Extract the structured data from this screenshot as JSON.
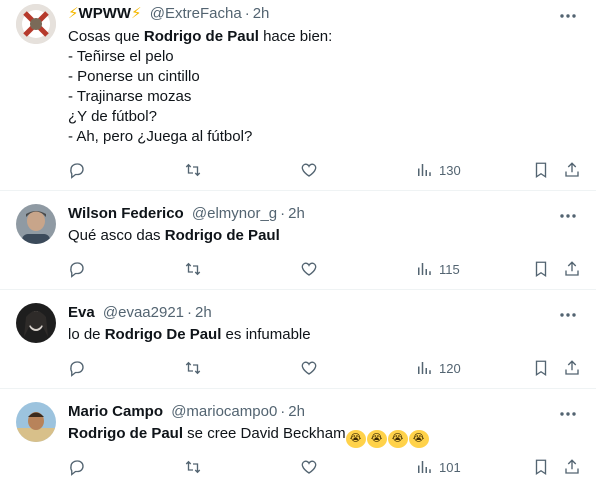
{
  "tweets": [
    {
      "name_prefix": "⚡",
      "name": "WPWW",
      "name_suffix": "⚡",
      "handle": "@ExtreFacha",
      "dot": "·",
      "time": "2h",
      "lines": [
        {
          "pre": "Cosas que ",
          "bold": "Rodrigo de Paul",
          "post": " hace bien:"
        },
        {
          "pre": "- Teñirse el pelo",
          "bold": "",
          "post": ""
        },
        {
          "pre": "- Ponerse un cintillo",
          "bold": "",
          "post": ""
        },
        {
          "pre": "- Trajinarse mozas",
          "bold": "",
          "post": ""
        },
        {
          "pre": "¿Y de fútbol?",
          "bold": "",
          "post": ""
        },
        {
          "pre": "- Ah, pero ¿Juega al fútbol?",
          "bold": "",
          "post": ""
        }
      ],
      "views": "130"
    },
    {
      "name": "Wilson Federico",
      "handle": "@elmynor_g",
      "dot": "·",
      "time": "2h",
      "lines": [
        {
          "pre": "Qué asco das ",
          "bold": "Rodrigo de Paul",
          "post": ""
        }
      ],
      "views": "115"
    },
    {
      "name": "Eva",
      "handle": "@evaa2921",
      "dot": "·",
      "time": "2h",
      "lines": [
        {
          "pre": "lo de ",
          "bold": "Rodrigo De Paul",
          "post": " es infumable"
        }
      ],
      "views": "120"
    },
    {
      "name": "Mario Campo",
      "handle": "@mariocampo0",
      "dot": "·",
      "time": "2h",
      "lines": [
        {
          "pre": "",
          "bold": "Rodrigo de Paul",
          "post": " se cree David Beckham"
        }
      ],
      "emojis": [
        "😭",
        "😭",
        "😭",
        "😭"
      ],
      "views": "101"
    }
  ],
  "icons": {
    "more": "more-horizontal-icon",
    "reply": "reply-icon",
    "retweet": "retweet-icon",
    "like": "like-icon",
    "views": "views-icon",
    "bookmark": "bookmark-icon",
    "share": "share-icon"
  },
  "colors": {
    "text": "#0f1419",
    "secondary": "#536471",
    "divider": "#eff3f4",
    "bolt": "#f5b800"
  }
}
